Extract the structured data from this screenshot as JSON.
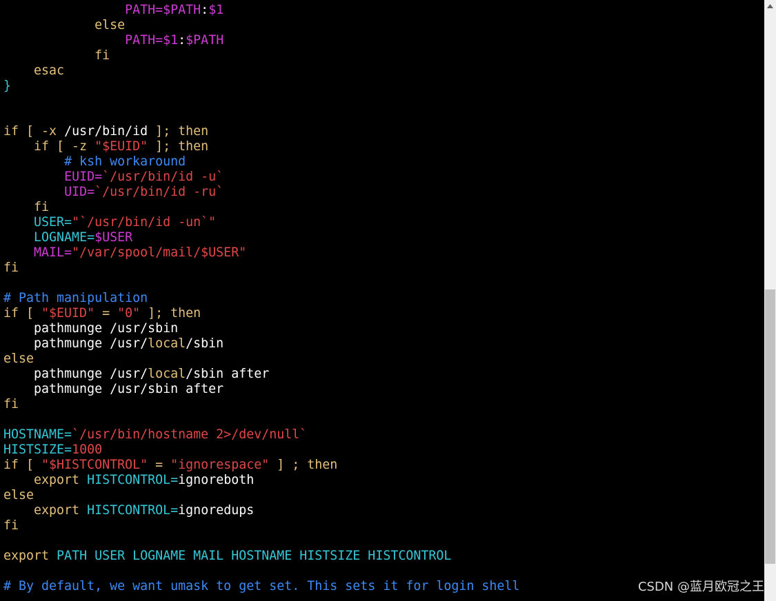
{
  "terminal": {
    "colors": {
      "background": "#000000",
      "default": "#ffffff",
      "keyword": "#e5c07b",
      "variable": "#ce3bd3",
      "string": "#e04848",
      "comment": "#3d8af7",
      "identifier": "#35c8d8"
    },
    "lines": [
      [
        {
          "t": "                ",
          "c": "default"
        },
        {
          "t": "PATH=$PATH",
          "c": "variable"
        },
        {
          "t": ":",
          "c": "default"
        },
        {
          "t": "$1",
          "c": "variable"
        }
      ],
      [
        {
          "t": "            ",
          "c": "default"
        },
        {
          "t": "else",
          "c": "keyword"
        }
      ],
      [
        {
          "t": "                ",
          "c": "default"
        },
        {
          "t": "PATH=$1",
          "c": "variable"
        },
        {
          "t": ":",
          "c": "default"
        },
        {
          "t": "$PATH",
          "c": "variable"
        }
      ],
      [
        {
          "t": "            ",
          "c": "default"
        },
        {
          "t": "fi",
          "c": "keyword"
        }
      ],
      [
        {
          "t": "    ",
          "c": "default"
        },
        {
          "t": "esac",
          "c": "keyword"
        }
      ],
      [
        {
          "t": "}",
          "c": "identifier"
        }
      ],
      [],
      [],
      [
        {
          "t": "if [ -x ",
          "c": "keyword"
        },
        {
          "t": "/usr/bin/id",
          "c": "default"
        },
        {
          "t": " ]; then",
          "c": "keyword"
        }
      ],
      [
        {
          "t": "    ",
          "c": "default"
        },
        {
          "t": "if [ -z ",
          "c": "keyword"
        },
        {
          "t": "\"$EUID\"",
          "c": "string"
        },
        {
          "t": " ]; then",
          "c": "keyword"
        }
      ],
      [
        {
          "t": "        ",
          "c": "default"
        },
        {
          "t": "# ksh workaround",
          "c": "comment"
        }
      ],
      [
        {
          "t": "        ",
          "c": "default"
        },
        {
          "t": "EUID=",
          "c": "variable"
        },
        {
          "t": "`/usr/bin/id -u`",
          "c": "string"
        }
      ],
      [
        {
          "t": "        ",
          "c": "default"
        },
        {
          "t": "UID=",
          "c": "variable"
        },
        {
          "t": "`/usr/bin/id -ru`",
          "c": "string"
        }
      ],
      [
        {
          "t": "    ",
          "c": "default"
        },
        {
          "t": "fi",
          "c": "keyword"
        }
      ],
      [
        {
          "t": "    ",
          "c": "default"
        },
        {
          "t": "USER=",
          "c": "identifier"
        },
        {
          "t": "\"`/usr/bin/id -un`\"",
          "c": "string"
        }
      ],
      [
        {
          "t": "    ",
          "c": "default"
        },
        {
          "t": "LOGNAME=",
          "c": "identifier"
        },
        {
          "t": "$USER",
          "c": "variable"
        }
      ],
      [
        {
          "t": "    ",
          "c": "default"
        },
        {
          "t": "MAIL=",
          "c": "variable"
        },
        {
          "t": "\"/var/spool/mail/$USER\"",
          "c": "string"
        }
      ],
      [
        {
          "t": "fi",
          "c": "keyword"
        }
      ],
      [],
      [
        {
          "t": "# Path manipulation",
          "c": "comment"
        }
      ],
      [
        {
          "t": "if [ ",
          "c": "keyword"
        },
        {
          "t": "\"$EUID\"",
          "c": "string"
        },
        {
          "t": " = ",
          "c": "keyword"
        },
        {
          "t": "\"0\"",
          "c": "string"
        },
        {
          "t": " ]; then",
          "c": "keyword"
        }
      ],
      [
        {
          "t": "    pathmunge /usr/sbin",
          "c": "default"
        }
      ],
      [
        {
          "t": "    pathmunge /usr/",
          "c": "default"
        },
        {
          "t": "local",
          "c": "keyword"
        },
        {
          "t": "/sbin",
          "c": "default"
        }
      ],
      [
        {
          "t": "else",
          "c": "keyword"
        }
      ],
      [
        {
          "t": "    pathmunge /usr/",
          "c": "default"
        },
        {
          "t": "local",
          "c": "keyword"
        },
        {
          "t": "/sbin after",
          "c": "default"
        }
      ],
      [
        {
          "t": "    pathmunge /usr/sbin after",
          "c": "default"
        }
      ],
      [
        {
          "t": "fi",
          "c": "keyword"
        }
      ],
      [],
      [
        {
          "t": "HOSTNAME=",
          "c": "identifier"
        },
        {
          "t": "`/usr/bin/hostname 2>/dev/null`",
          "c": "string"
        }
      ],
      [
        {
          "t": "HISTSIZE=",
          "c": "identifier"
        },
        {
          "t": "1000",
          "c": "string"
        }
      ],
      [
        {
          "t": "if [ ",
          "c": "keyword"
        },
        {
          "t": "\"$HISTCONTROL\"",
          "c": "string"
        },
        {
          "t": " = ",
          "c": "keyword"
        },
        {
          "t": "\"ignorespace\"",
          "c": "string"
        },
        {
          "t": " ] ; then",
          "c": "keyword"
        }
      ],
      [
        {
          "t": "    ",
          "c": "default"
        },
        {
          "t": "export",
          "c": "keyword"
        },
        {
          "t": " ",
          "c": "default"
        },
        {
          "t": "HISTCONTROL=",
          "c": "identifier"
        },
        {
          "t": "ignoreboth",
          "c": "default"
        }
      ],
      [
        {
          "t": "else",
          "c": "keyword"
        }
      ],
      [
        {
          "t": "    ",
          "c": "default"
        },
        {
          "t": "export",
          "c": "keyword"
        },
        {
          "t": " ",
          "c": "default"
        },
        {
          "t": "HISTCONTROL=",
          "c": "identifier"
        },
        {
          "t": "ignoredups",
          "c": "default"
        }
      ],
      [
        {
          "t": "fi",
          "c": "keyword"
        }
      ],
      [],
      [
        {
          "t": "export",
          "c": "keyword"
        },
        {
          "t": " PATH USER LOGNAME MAIL HOSTNAME HISTSIZE HISTCONTROL",
          "c": "identifier"
        }
      ],
      [],
      [
        {
          "t": "# By default, we want umask to get set. This sets it for login shell",
          "c": "comment"
        }
      ]
    ]
  },
  "scrollbar": {
    "up_icon": "triangle-up-icon"
  },
  "watermark": {
    "text": "CSDN @蓝月欧冠之王"
  }
}
